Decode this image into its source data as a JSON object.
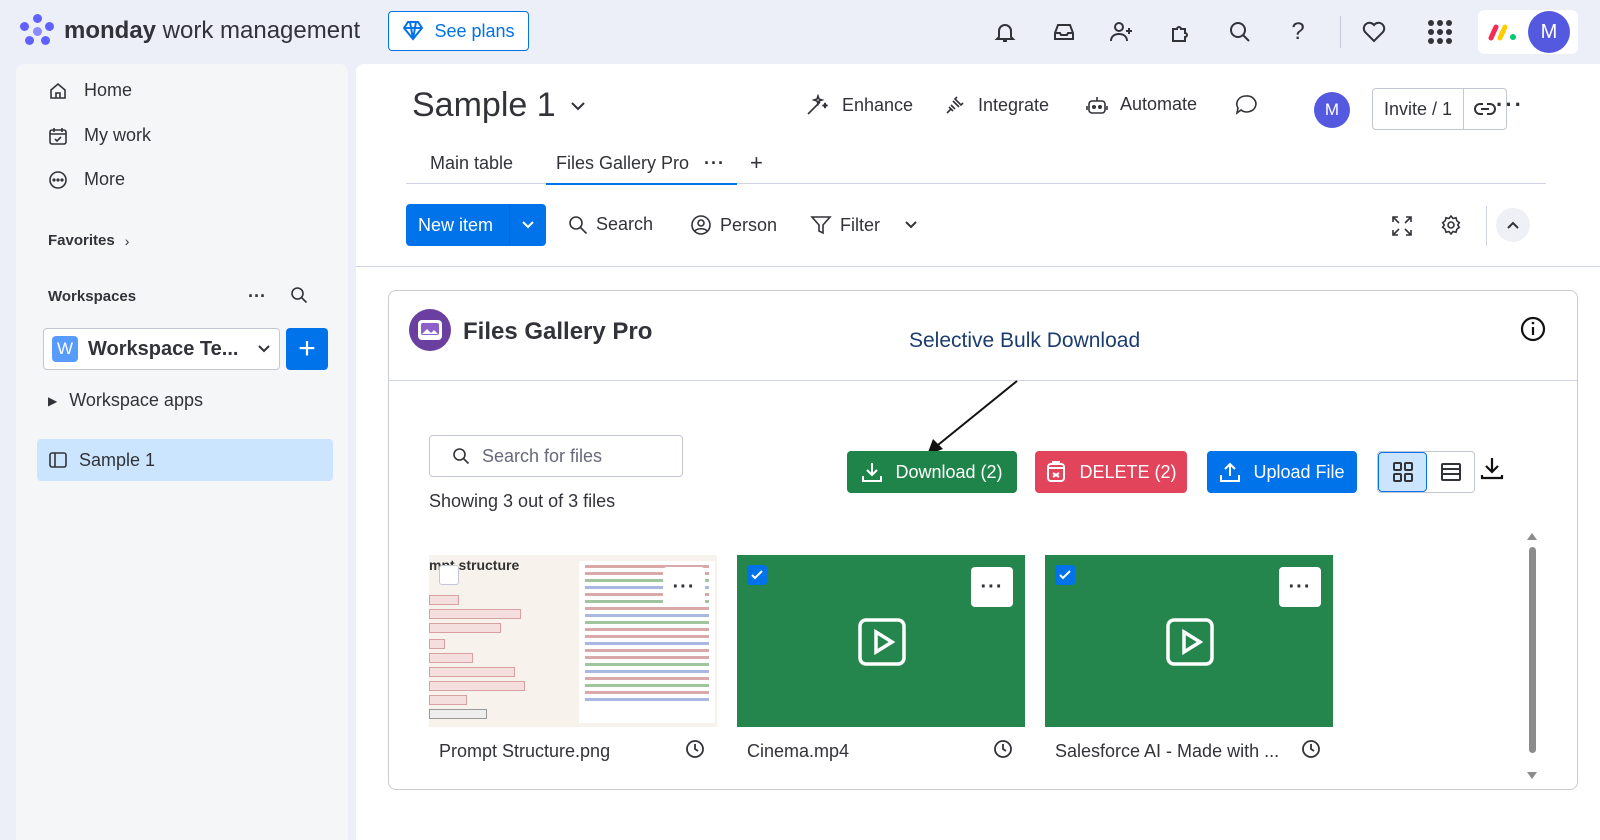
{
  "topbar": {
    "brand_bold": "monday",
    "brand_rest": " work management",
    "see_plans": "See plans",
    "avatar": "M"
  },
  "sidebar": {
    "nav": [
      {
        "label": "Home",
        "icon": "home-icon"
      },
      {
        "label": "My work",
        "icon": "calendar-check-icon"
      },
      {
        "label": "More",
        "icon": "more-circle-icon"
      }
    ],
    "favorites": "Favorites",
    "workspaces": "Workspaces",
    "workspace_letter": "W",
    "workspace_name": "Workspace Te...",
    "workspace_apps": "Workspace apps",
    "board_item": "Sample 1"
  },
  "board": {
    "title": "Sample 1",
    "actions": {
      "enhance": "Enhance",
      "integrate": "Integrate",
      "automate": "Automate"
    },
    "avatar": "M",
    "invite": "Invite / 1",
    "tabs": {
      "main": "Main table",
      "gallery": "Files Gallery Pro",
      "add": "+"
    },
    "toolbar": {
      "new_item": "New item",
      "search": "Search",
      "person": "Person",
      "filter": "Filter"
    }
  },
  "app": {
    "name": "Files Gallery Pro",
    "annotation": "Selective Bulk Download",
    "search_placeholder": "Search for files",
    "showing": "Showing 3 out of 3 files",
    "download_btn": "Download (2)",
    "delete_btn": "DELETE (2)",
    "upload_btn": "Upload File",
    "thumb_text": "mpt structure",
    "files": [
      {
        "name": "Prompt Structure.png",
        "selected": false
      },
      {
        "name": "Cinema.mp4",
        "selected": true
      },
      {
        "name": "Salesforce AI - Made with ...",
        "selected": true
      }
    ]
  },
  "colors": {
    "primary": "#0073ea",
    "download": "#1e8449",
    "delete": "#e2445c",
    "video_card": "#24864d",
    "sidebar_selected": "#cce5ff"
  }
}
